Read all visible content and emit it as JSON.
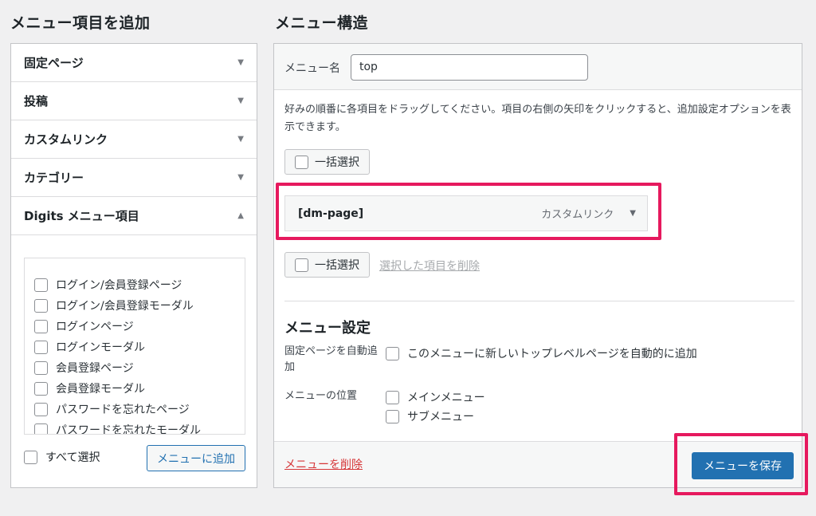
{
  "left": {
    "title": "メニュー項目を追加",
    "accordion": [
      {
        "label": "固定ページ",
        "arrow": "▼"
      },
      {
        "label": "投稿",
        "arrow": "▼"
      },
      {
        "label": "カスタムリンク",
        "arrow": "▼"
      },
      {
        "label": "カテゴリー",
        "arrow": "▼"
      },
      {
        "label": "Digits メニュー項目",
        "arrow": "▲"
      }
    ],
    "digits_items": [
      "ログイン/会員登録ページ",
      "ログイン/会員登録モーダル",
      "ログインページ",
      "ログインモーダル",
      "会員登録ページ",
      "会員登録モーダル",
      "パスワードを忘れたページ",
      "パスワードを忘れたモーダル"
    ],
    "select_all_label": "すべて選択",
    "add_button_label": "メニューに追加"
  },
  "right": {
    "title": "メニュー構造",
    "menu_name_label": "メニュー名",
    "menu_name_value": "top",
    "instructions": "好みの順番に各項目をドラッグしてください。項目の右側の矢印をクリックすると、追加設定オプションを表示できます。",
    "bulk_select_label": "一括選択",
    "menu_item": {
      "title": "[dm-page]",
      "type": "カスタムリンク",
      "arrow": "▼"
    },
    "delete_selected_label": "選択した項目を削除",
    "settings": {
      "title": "メニュー設定",
      "auto_add_label": "固定ページを自動追加",
      "auto_add_option": "このメニューに新しいトップレベルページを自動的に追加",
      "location_label": "メニューの位置",
      "locations": [
        "メインメニュー",
        "サブメニュー"
      ]
    },
    "delete_menu_label": "メニューを削除",
    "save_label": "メニューを保存"
  },
  "colors": {
    "highlight": "#e6195e",
    "primary": "#2271b1",
    "danger": "#d63638"
  }
}
